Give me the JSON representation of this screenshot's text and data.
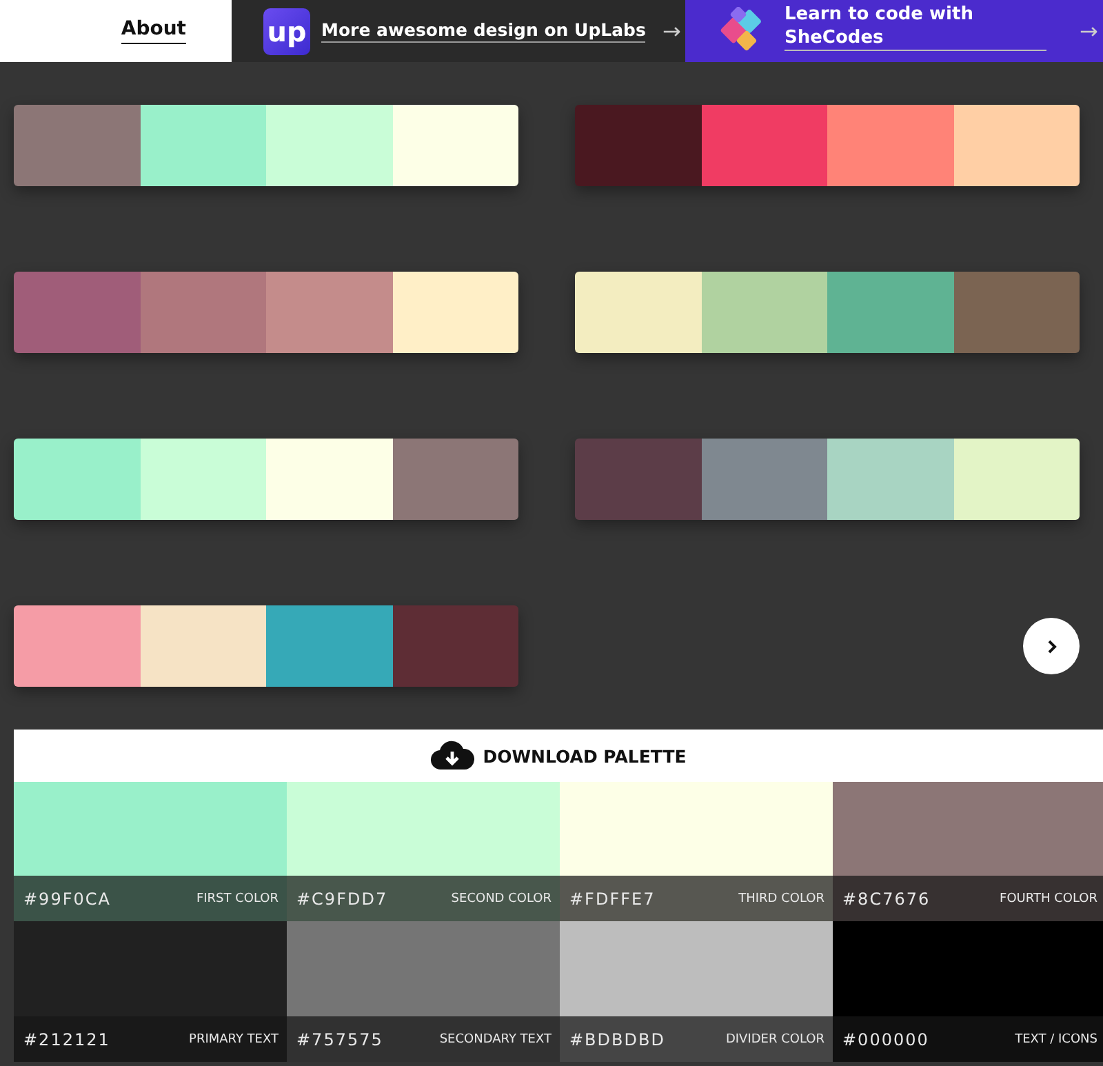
{
  "nav": {
    "about": "About"
  },
  "uplabs": {
    "logo": "up",
    "text": "More awesome design on UpLabs",
    "arrow": "→"
  },
  "shecodes": {
    "text": "Learn to code with SheCodes",
    "arrow": "→"
  },
  "palettes": [
    {
      "colors": [
        {
          "color": "#8c7676"
        },
        {
          "color": "#99f0ca"
        },
        {
          "color": "#c9fdd7"
        },
        {
          "color": "#fdffe7"
        }
      ]
    },
    {
      "colors": [
        {
          "color": "#4a1820"
        },
        {
          "color": "#f03c63"
        },
        {
          "color": "#ff8377"
        },
        {
          "color": "#ffcfa5"
        }
      ]
    },
    {
      "colors": [
        {
          "color": "#a05d79"
        },
        {
          "color": "#b0777d"
        },
        {
          "color": "#c48c8b"
        },
        {
          "color": "#ffefc7"
        }
      ]
    },
    {
      "colors": [
        {
          "color": "#f3edc0"
        },
        {
          "color": "#b0d2a0"
        },
        {
          "color": "#5fb393"
        },
        {
          "color": "#7b6452"
        }
      ]
    },
    {
      "colors": [
        {
          "color": "#99f0ca"
        },
        {
          "color": "#c9fdd7"
        },
        {
          "color": "#fdffe7"
        },
        {
          "color": "#8c7676"
        }
      ]
    },
    {
      "colors": [
        {
          "color": "#5c3d48"
        },
        {
          "color": "#7f8890"
        },
        {
          "color": "#a8d4c2"
        },
        {
          "color": "#e3f4c6"
        }
      ]
    },
    {
      "colors": [
        {
          "color": "#f59ca6"
        },
        {
          "color": "#f6e3c5"
        },
        {
          "color": "#36a9b7"
        },
        {
          "color": "#5e2d35"
        }
      ]
    }
  ],
  "download": {
    "label": "DOWNLOAD PALETTE"
  },
  "swatches": [
    {
      "hex": "#99F0CA",
      "role": "FIRST COLOR",
      "color": "#99f0ca"
    },
    {
      "hex": "#C9FDD7",
      "role": "SECOND COLOR",
      "color": "#c9fdd7"
    },
    {
      "hex": "#FDFFE7",
      "role": "THIRD COLOR",
      "color": "#fdffe7"
    },
    {
      "hex": "#8C7676",
      "role": "FOURTH COLOR",
      "color": "#8c7676"
    },
    {
      "hex": "#212121",
      "role": "PRIMARY TEXT",
      "color": "#212121"
    },
    {
      "hex": "#757575",
      "role": "SECONDARY TEXT",
      "color": "#757575"
    },
    {
      "hex": "#BDBDBD",
      "role": "DIVIDER COLOR",
      "color": "#bdbdbd"
    },
    {
      "hex": "#000000",
      "role": "TEXT / ICONS",
      "color": "#000000"
    }
  ]
}
